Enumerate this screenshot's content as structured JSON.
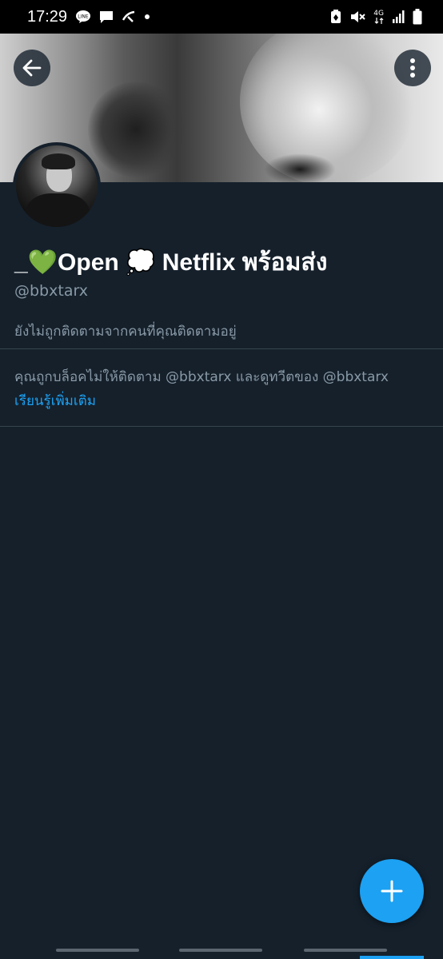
{
  "status_bar": {
    "time": "17:29",
    "network": "4G",
    "icons": [
      "line-icon",
      "message-icon",
      "carrier-icon",
      "dot-icon",
      "battery-saver-icon",
      "mute-icon",
      "signal-icon",
      "battery-icon"
    ]
  },
  "header": {
    "back_icon": "back-arrow-icon",
    "more_icon": "more-vertical-icon"
  },
  "profile": {
    "display_name": "_💚Open 💭 Netflix พร้อมส่ง",
    "handle": "@bbxtarx",
    "follow_note": "ยังไม่ถูกติดตามจากคนที่คุณติดตามอยู่"
  },
  "blocked": {
    "message": "คุณถูกบล็อคไม่ให้ติดตาม @bbxtarx และดูทวีตของ @bbxtarx",
    "learn_more": "เรียนรู้เพิ่มเติม"
  },
  "fab": {
    "icon": "plus-icon"
  },
  "colors": {
    "background": "#15202b",
    "accent": "#1da1f2",
    "secondary_text": "#8899a6",
    "divider": "#38444d"
  }
}
